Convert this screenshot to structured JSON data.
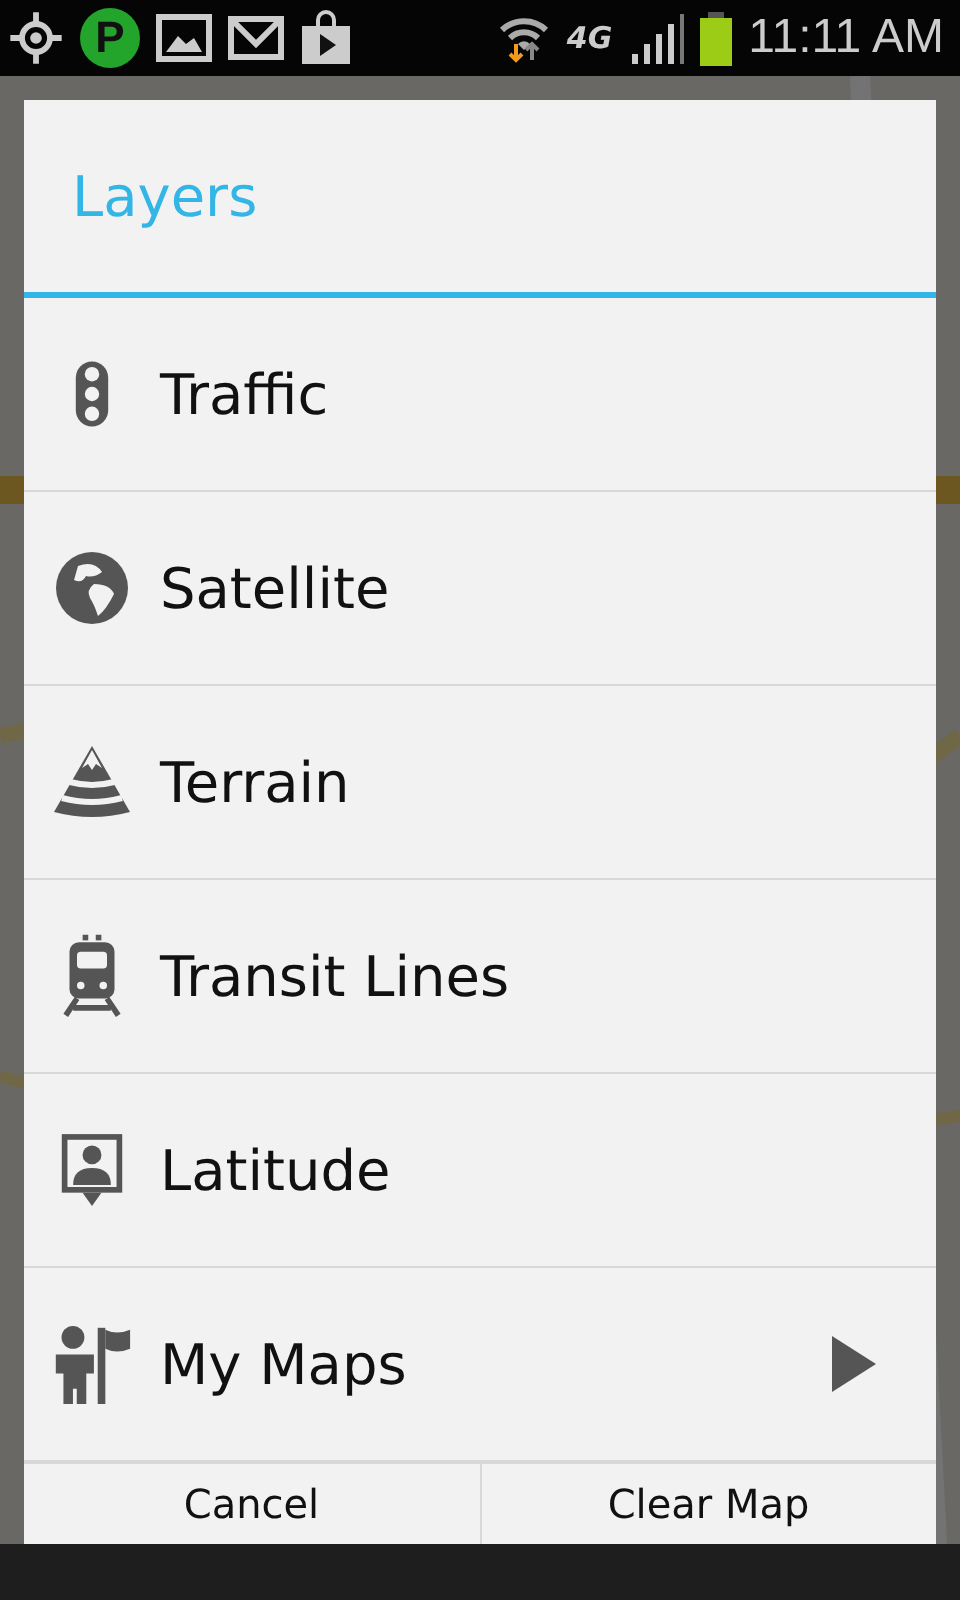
{
  "status_bar": {
    "app_badge": "P",
    "network": "4G",
    "time": "11:11 AM"
  },
  "dialog": {
    "title": "Layers",
    "items": [
      {
        "label": "Traffic",
        "has_submenu": false
      },
      {
        "label": "Satellite",
        "has_submenu": false
      },
      {
        "label": "Terrain",
        "has_submenu": false
      },
      {
        "label": "Transit Lines",
        "has_submenu": false
      },
      {
        "label": "Latitude",
        "has_submenu": false
      },
      {
        "label": "My Maps",
        "has_submenu": true
      }
    ],
    "buttons": [
      "Cancel",
      "Clear Map"
    ]
  }
}
